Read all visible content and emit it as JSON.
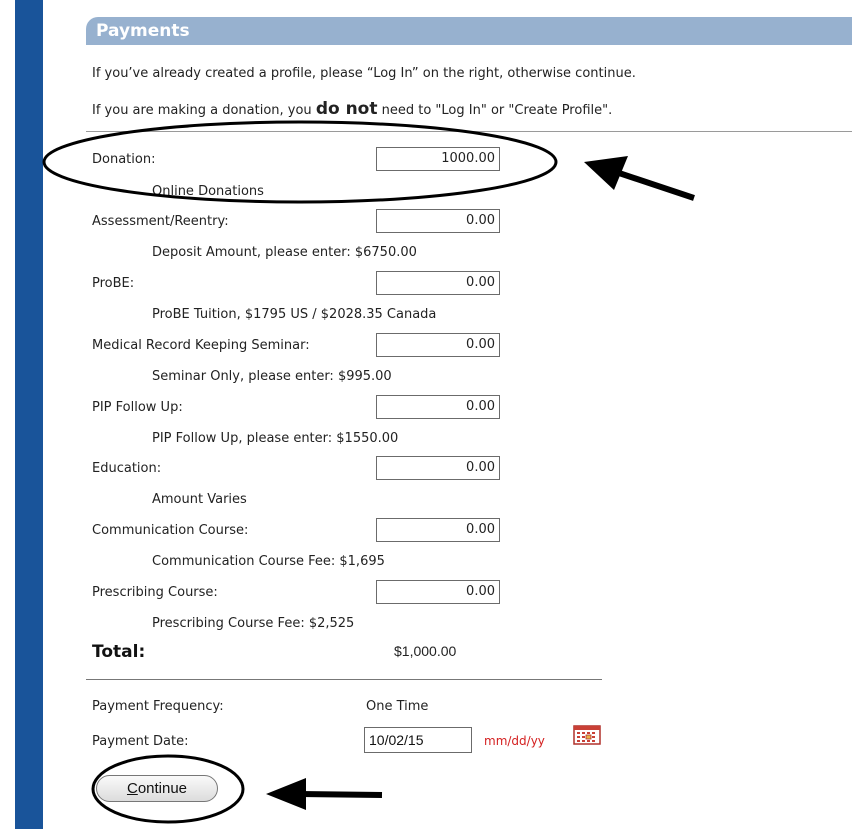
{
  "header": {
    "title": "Payments"
  },
  "intro": {
    "line1": "If you’ve already created a profile, please “Log In” on the right, otherwise continue.",
    "line2_pre": "If you are making a donation, you ",
    "line2_emph": "do not",
    "line2_post": " need to \"Log In\" or \"Create Profile\"."
  },
  "items": [
    {
      "label": "Donation:",
      "value": "1000.00",
      "note": "Online Donations"
    },
    {
      "label": "Assessment/Reentry:",
      "value": "0.00",
      "note": "Deposit Amount, please enter: $6750.00"
    },
    {
      "label": "ProBE:",
      "value": "0.00",
      "note": "ProBE Tuition, $1795 US / $2028.35 Canada"
    },
    {
      "label": "Medical Record Keeping Seminar:",
      "value": "0.00",
      "note": "Seminar Only, please enter: $995.00"
    },
    {
      "label": "PIP Follow Up:",
      "value": "0.00",
      "note": "PIP Follow Up, please enter: $1550.00"
    },
    {
      "label": "Education:",
      "value": "0.00",
      "note": "Amount Varies"
    },
    {
      "label": "Communication Course:",
      "value": "0.00",
      "note": "Communication Course Fee: $1,695"
    },
    {
      "label": "Prescribing Course:",
      "value": "0.00",
      "note": "Prescribing Course Fee: $2,525"
    }
  ],
  "total": {
    "label": "Total:",
    "value": "$1,000.00"
  },
  "frequency": {
    "label": "Payment Frequency:",
    "value": "One Time"
  },
  "date": {
    "label": "Payment Date:",
    "value": "10/02/15",
    "hint": "mm/dd/yy"
  },
  "continue": {
    "first": "C",
    "rest": "ontinue"
  },
  "colors": {
    "sidebar": "#19549a",
    "header": "#97b1cf",
    "hint": "#d42020"
  }
}
